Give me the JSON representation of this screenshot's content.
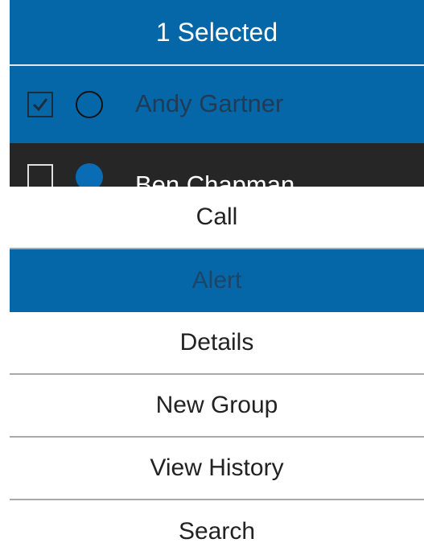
{
  "header": {
    "title": "1 Selected"
  },
  "contacts": [
    {
      "name": "Andy Gartner",
      "checked": true,
      "presence": "offline-outline"
    },
    {
      "name": "Ben Chapman",
      "checked": false,
      "presence": "online-filled"
    }
  ],
  "menu": {
    "items": [
      {
        "label": "Call"
      },
      {
        "label": "Alert"
      },
      {
        "label": "Details"
      },
      {
        "label": "New Group"
      },
      {
        "label": "View History"
      },
      {
        "label": "Search"
      }
    ],
    "active_index": 1
  },
  "colors": {
    "accent": "#0567a8",
    "dark_row": "#262626",
    "divider": "#a9a9a9"
  },
  "icons": {
    "checkbox_checked": "checkbox-checked-icon",
    "checkbox_empty": "checkbox-empty-icon",
    "presence_outline": "presence-outline-icon",
    "presence_filled": "presence-filled-icon"
  }
}
